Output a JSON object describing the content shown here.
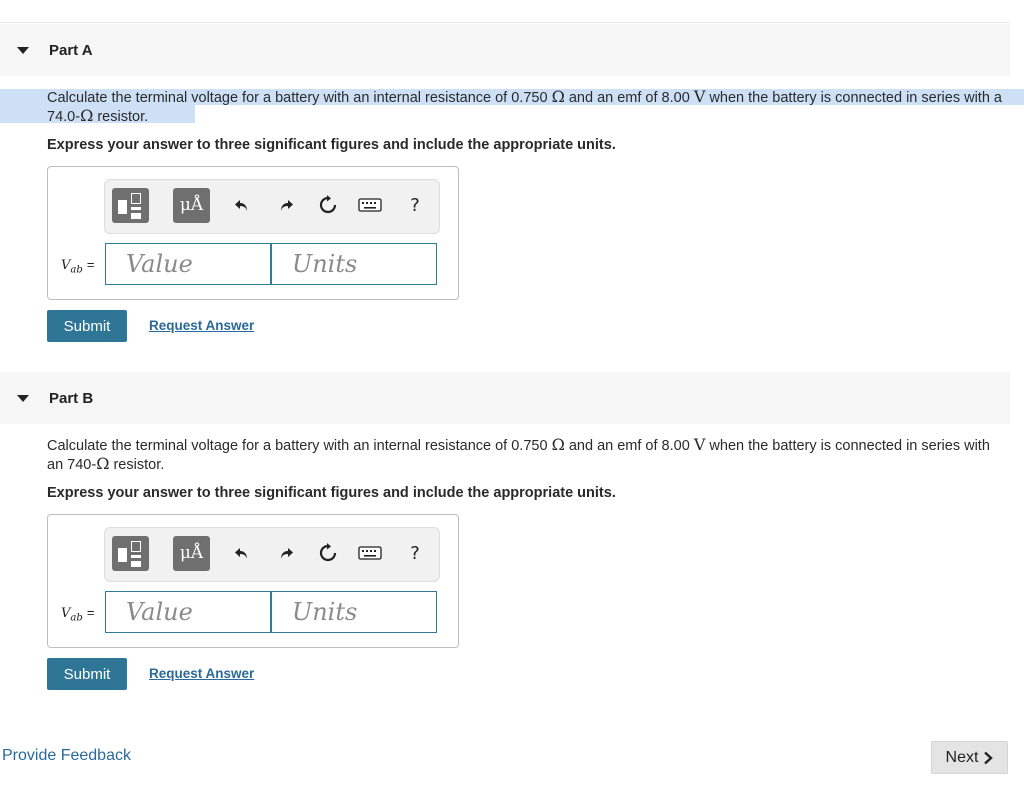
{
  "parts": [
    {
      "title": "Part A",
      "question_before": "Calculate the terminal voltage for a battery with an internal resistance of 0.750 ",
      "ohm_symbol": "Ω",
      "question_mid": " and an emf of 8.00 ",
      "volt_symbol": "V",
      "question_after": " when the battery is connected in series with a 74.0-",
      "ohm_symbol_2": "Ω",
      "question_end": " resistor.",
      "instruction": "Express your answer to three significant figures and include the appropriate units.",
      "variable": "V",
      "variable_sub": "ab",
      "equals": "=",
      "value_placeholder": "Value",
      "units_placeholder": "Units",
      "units_button_label": "μÅ",
      "help_label": "?",
      "submit_label": "Submit",
      "request_answer_label": "Request Answer"
    },
    {
      "title": "Part B",
      "question_before": "Calculate the terminal voltage for a battery with an internal resistance of 0.750 ",
      "ohm_symbol": "Ω",
      "question_mid": " and an emf of 8.00 ",
      "volt_symbol": "V",
      "question_after": " when the battery is connected in series with an 740-",
      "ohm_symbol_2": "Ω",
      "question_end": " resistor.",
      "instruction": "Express your answer to three significant figures and include the appropriate units.",
      "variable": "V",
      "variable_sub": "ab",
      "equals": "=",
      "value_placeholder": "Value",
      "units_placeholder": "Units",
      "units_button_label": "μÅ",
      "help_label": "?",
      "submit_label": "Submit",
      "request_answer_label": "Request Answer"
    }
  ],
  "footer": {
    "feedback_label": "Provide Feedback",
    "next_label": "Next"
  },
  "colors": {
    "accent": "#2f7595",
    "link": "#2a6a9b",
    "selection_highlight": "#cde0f6",
    "header_bg": "#f6f6f6"
  },
  "icons": [
    "caret-down-icon",
    "templates-icon",
    "undo-icon",
    "redo-icon",
    "reset-icon",
    "keyboard-icon",
    "help-icon",
    "chevron-right-icon"
  ]
}
